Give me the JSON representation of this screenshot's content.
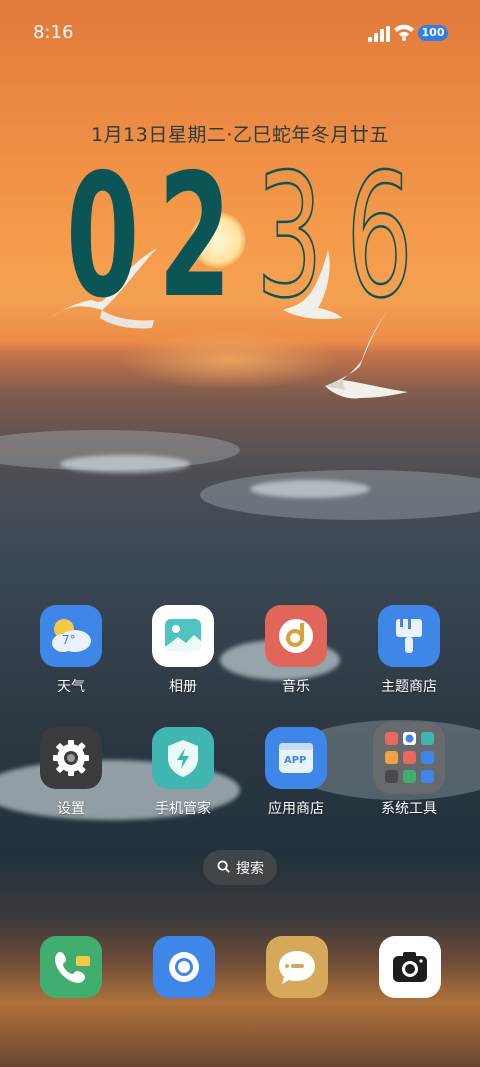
{
  "status_bar": {
    "time": "8:16",
    "battery_level": "100",
    "signal_icon": "cellular-signal-icon",
    "wifi_icon": "wifi-icon"
  },
  "lockscreen": {
    "date": "1月13日星期二·乙巳蛇年冬月廿五",
    "clock": {
      "h1": "0",
      "h2": "2",
      "m1": "3",
      "m2": "6"
    }
  },
  "apps": [
    {
      "label": "天气",
      "icon": "weather-icon",
      "color": "#3e87e8",
      "temp": "7°"
    },
    {
      "label": "相册",
      "icon": "gallery-icon",
      "color": "#ffffff"
    },
    {
      "label": "音乐",
      "icon": "music-icon",
      "color": "#e0665a"
    },
    {
      "label": "主题商店",
      "icon": "theme-store-icon",
      "color": "#3e87e8"
    },
    {
      "label": "设置",
      "icon": "settings-icon",
      "color": "#3b3b3d"
    },
    {
      "label": "手机管家",
      "icon": "phone-manager-icon",
      "color": "#3fb6b0"
    },
    {
      "label": "应用商店",
      "icon": "app-store-icon",
      "color": "#3e87e8",
      "badge": "APP"
    },
    {
      "label": "系统工具",
      "icon": "folder-icon",
      "color": "#6c6c6c"
    }
  ],
  "search": {
    "label": "搜索",
    "icon": "search-icon"
  },
  "dock": [
    {
      "icon": "phone-icon",
      "color": "#3fae6f"
    },
    {
      "icon": "browser-icon",
      "color": "#3e87e8"
    },
    {
      "icon": "messages-icon",
      "color": "#d6a85a"
    },
    {
      "icon": "camera-icon",
      "color": "#ffffff"
    }
  ]
}
